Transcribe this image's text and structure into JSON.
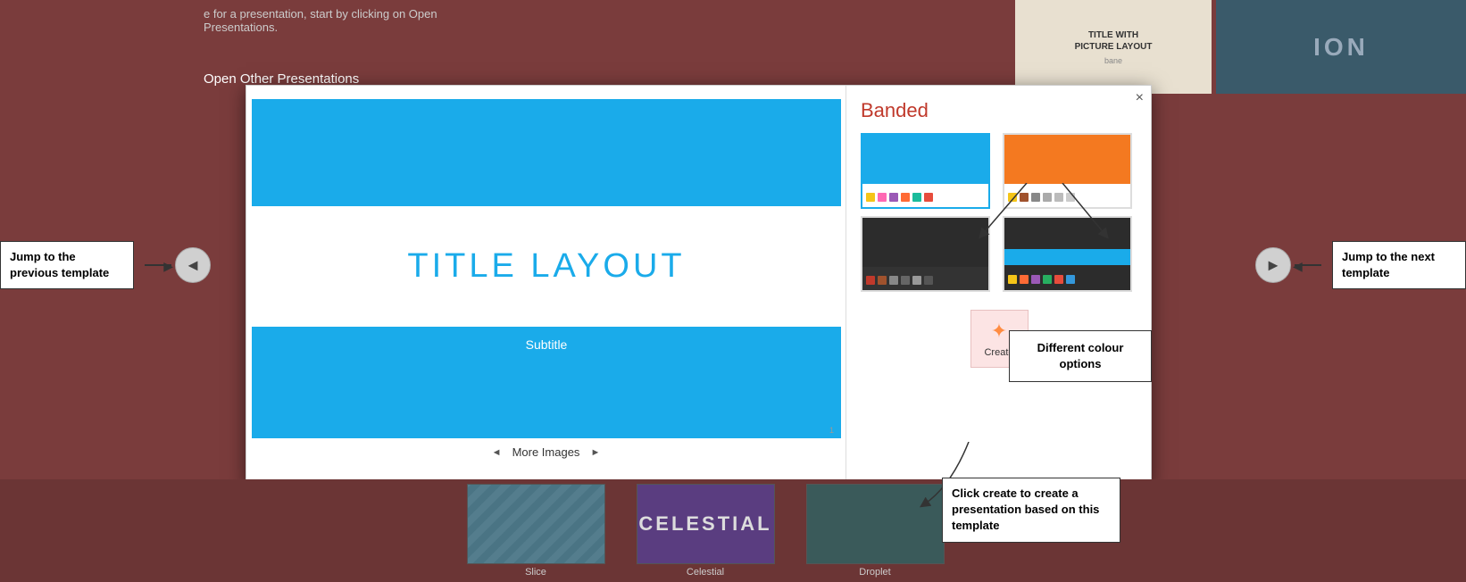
{
  "background": {
    "top_text": "e for a presentation, start by clicking on Open Presentations.",
    "open_link": "Open Other Presentations",
    "ion_label": "ION",
    "title_with_picture": "TITLE WITH\nPICTURE LAYOUT",
    "subtitle_small": "bane"
  },
  "left_nav": {
    "label": "Jump to the\nprevious template",
    "arrow": "◄"
  },
  "right_nav": {
    "label": "Jump to the\nnext template",
    "arrow": "►"
  },
  "modal": {
    "template_name": "Banded",
    "close_label": "×",
    "slide": {
      "title": "TITLE LAYOUT",
      "subtitle": "Subtitle"
    },
    "more_images": "More Images",
    "swatches": [
      {
        "id": "sw1",
        "selected": true,
        "top_color": "#1aabea",
        "bottom_bg": "#ffffff",
        "dots": [
          "#f5c518",
          "#ff69b4",
          "#9b59b6",
          "#ff6b35",
          "#1abc9c",
          "#e74c3c"
        ]
      },
      {
        "id": "sw2",
        "selected": false,
        "top_color": "#f47920",
        "bottom_bg": "#ffffff",
        "dots": [
          "#f5c518",
          "#a0522d",
          "#888",
          "#aaa",
          "#bbb",
          "#ccc"
        ]
      },
      {
        "id": "sw3",
        "selected": false,
        "top_color": "#2c2c2c",
        "bottom_bg": "#333333",
        "dots": [
          "#c0392b",
          "#a0522d",
          "#888",
          "#666",
          "#999",
          "#555"
        ]
      },
      {
        "id": "sw4",
        "selected": false,
        "top_color": "#1aabea",
        "bottom_bg": "#2c2c2c",
        "dots": [
          "#f5c518",
          "#ff6b35",
          "#9b59b6",
          "#27ae60",
          "#e74c3c",
          "#3498db"
        ]
      }
    ],
    "create_label": "Create",
    "colour_callout": "Different colour\noptions"
  },
  "bottom_strip": {
    "items": [
      {
        "label": "Slice",
        "type": "slice"
      },
      {
        "label": "Celestial",
        "type": "celestial",
        "text": "CELESTIAL"
      },
      {
        "label": "Droplet",
        "type": "droplet"
      }
    ]
  },
  "callouts": {
    "prev_template": "Jump to the\nprevious template",
    "next_template": "Jump to the\nnext template",
    "create_hint": "Click create to create\na presentation based\non this template",
    "colour_options": "Different colour\noptions"
  }
}
